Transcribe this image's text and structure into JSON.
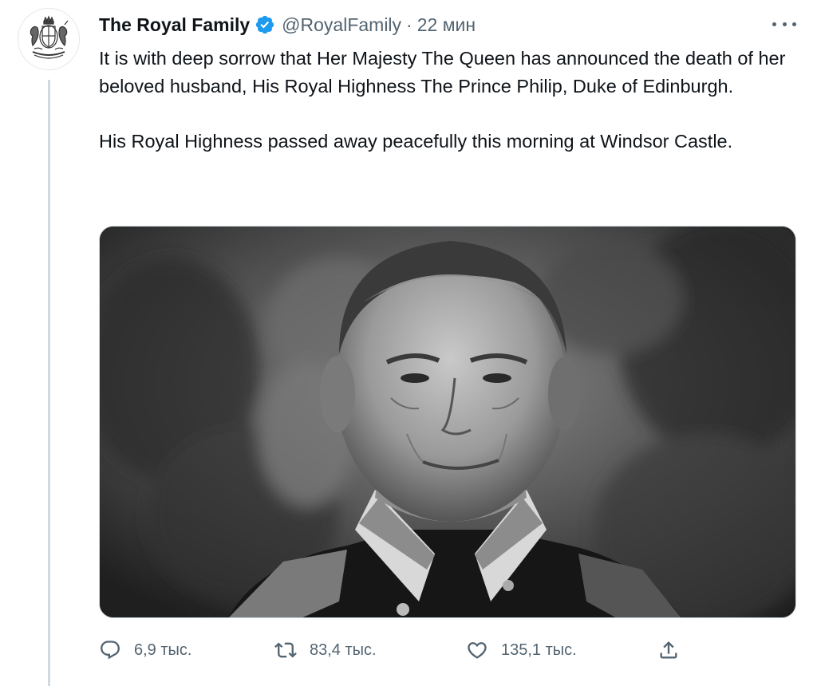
{
  "tweet": {
    "author": {
      "display_name": "The Royal Family",
      "handle": "@RoyalFamily",
      "verified": true,
      "avatar_icon": "royal-coat-of-arms-icon"
    },
    "separator": "·",
    "time": "22 мин",
    "paragraphs": [
      "It is with deep sorrow that Her Majesty The Queen has announced the death of her beloved husband, His Royal Highness The Prince Philip, Duke of Edinburgh.",
      "His Royal Highness passed away peacefully this morning at Windsor Castle."
    ],
    "media": {
      "type": "photo",
      "style": "black-and-white portrait"
    },
    "actions": {
      "reply_count": "6,9 тыс.",
      "retweet_count": "83,4 тыс.",
      "like_count": "135,1 тыс.",
      "share_icon": "share-icon"
    }
  },
  "colors": {
    "text_primary": "#0f1419",
    "text_secondary": "#536471",
    "verified_blue": "#1d9bf0",
    "thread_line": "#cfd9de"
  }
}
